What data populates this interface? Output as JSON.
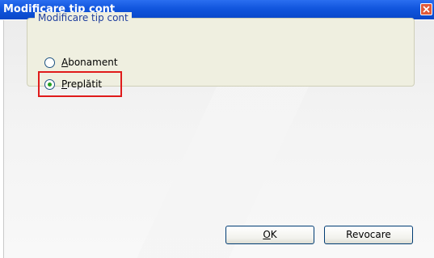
{
  "window": {
    "title": "Modificare tip cont"
  },
  "group": {
    "legend": "Modificare tip cont",
    "options": [
      {
        "prefix": "",
        "accel": "A",
        "rest": "bonament",
        "selected": false
      },
      {
        "prefix": "",
        "accel": "P",
        "rest": "replătit",
        "selected": true
      }
    ]
  },
  "buttons": {
    "ok_accel": "O",
    "ok_rest": "K",
    "cancel_label": "Revocare"
  },
  "colors": {
    "titlebar": "#1155dd",
    "highlight": "#e01b1b",
    "radio_selected": "#21a121"
  },
  "icons": {
    "close": "close-icon"
  }
}
